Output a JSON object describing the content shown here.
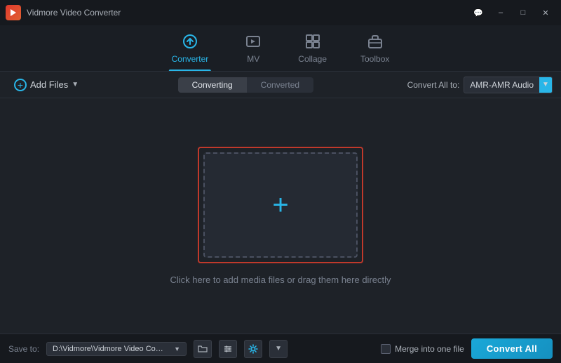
{
  "app": {
    "title": "Vidmore Video Converter",
    "logo_alt": "Vidmore Logo"
  },
  "titlebar": {
    "title": "Vidmore Video Converter",
    "controls": {
      "chat": "💬",
      "minimize": "—",
      "maximize": "□",
      "close": "✕"
    }
  },
  "nav": {
    "tabs": [
      {
        "id": "converter",
        "label": "Converter",
        "icon": "⟳",
        "active": true
      },
      {
        "id": "mv",
        "label": "MV",
        "icon": "🎬",
        "active": false
      },
      {
        "id": "collage",
        "label": "Collage",
        "icon": "▦",
        "active": false
      },
      {
        "id": "toolbox",
        "label": "Toolbox",
        "icon": "🧰",
        "active": false
      }
    ]
  },
  "toolbar": {
    "add_files_label": "Add Files",
    "sub_tabs": [
      {
        "id": "converting",
        "label": "Converting",
        "active": true
      },
      {
        "id": "converted",
        "label": "Converted",
        "active": false
      }
    ],
    "convert_all_to_label": "Convert All to:",
    "format_value": "AMR-AMR Audio"
  },
  "main": {
    "drop_hint": "Click here to add media files or drag them here directly",
    "drop_plus": "+"
  },
  "statusbar": {
    "save_to_label": "Save to:",
    "save_path": "D:\\Vidmore\\Vidmore Video Converter\\Converted",
    "merge_label": "Merge into one file",
    "convert_all_label": "Convert All"
  }
}
